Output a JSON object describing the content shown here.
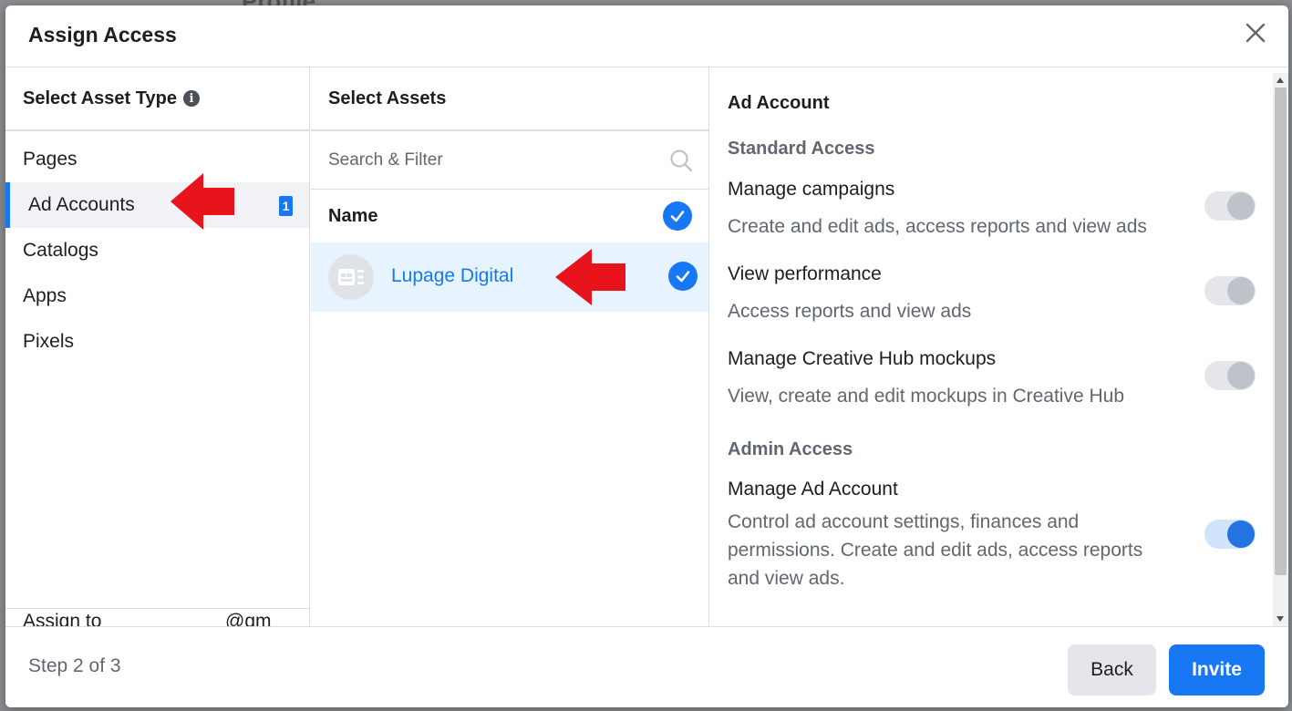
{
  "modal": {
    "title": "Assign Access",
    "close_icon": "close-icon"
  },
  "left_column": {
    "header": "Select Asset Type",
    "info_icon": "i",
    "items": [
      {
        "label": "Pages",
        "active": false
      },
      {
        "label": "Ad Accounts",
        "active": true,
        "badge": "1"
      },
      {
        "label": "Catalogs",
        "active": false
      },
      {
        "label": "Apps",
        "active": false
      },
      {
        "label": "Pixels",
        "active": false
      }
    ],
    "assign_to_label": "Assign to",
    "assign_to_email": "@gm"
  },
  "middle_column": {
    "header": "Select Assets",
    "search_placeholder": "Search & Filter",
    "name_header": "Name",
    "assets": [
      {
        "name": "Lupage Digital",
        "selected": true
      }
    ]
  },
  "right_column": {
    "header": "Ad Account",
    "standard_label": "Standard Access",
    "permissions": [
      {
        "name": "Manage campaigns",
        "desc": "Create and edit ads, access reports and view ads",
        "enabled": false
      },
      {
        "name": "View performance",
        "desc": "Access reports and view ads",
        "enabled": false
      },
      {
        "name": "Manage Creative Hub mockups",
        "desc": "View, create and edit mockups in Creative Hub",
        "enabled": false
      }
    ],
    "admin_label": "Admin Access",
    "admin_permission": {
      "name": "Manage Ad Account",
      "desc": "Control ad account settings, finances and permissions. Create and edit ads, access reports and view ads.",
      "enabled": true
    }
  },
  "footer": {
    "step": "Step 2 of 3",
    "back_label": "Back",
    "invite_label": "Invite"
  },
  "background": {
    "partial_title": "Profile"
  },
  "colors": {
    "accent": "#1877f2",
    "arrow": "#e8141b"
  }
}
